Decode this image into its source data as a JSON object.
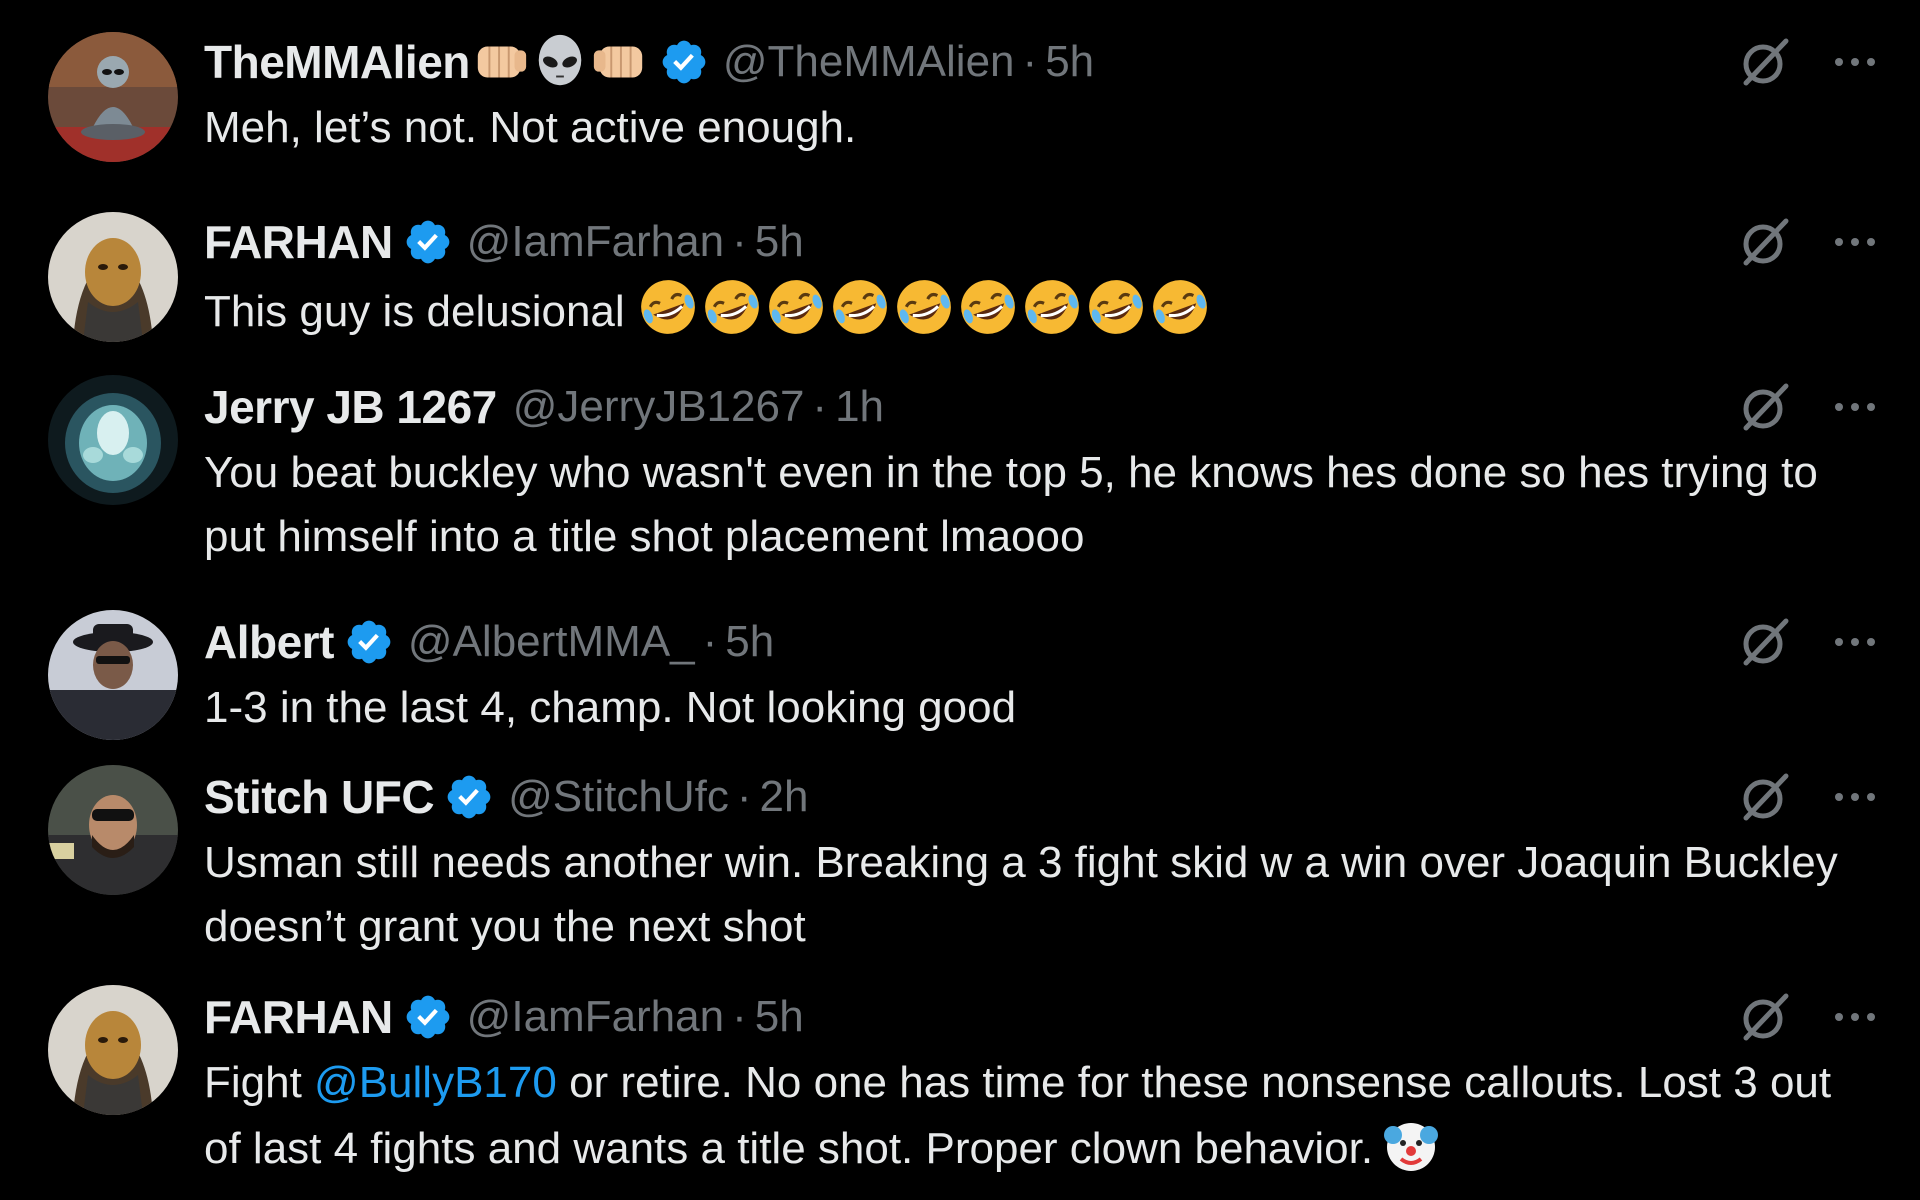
{
  "colors": {
    "background": "#000000",
    "text": "#e7e9ea",
    "muted": "#71767b",
    "accent": "#1d9bf0",
    "verified": "#1d9bf0"
  },
  "replies": [
    {
      "name": "TheMMAlien",
      "name_emojis": [
        "fist-left-emoji",
        "alien-emoji",
        "fist-right-emoji"
      ],
      "verified": true,
      "handle": "@TheMMAlien",
      "separator": "·",
      "time": "5h",
      "text": "Meh, let’s not. Not active enough."
    },
    {
      "name": "FARHAN",
      "verified": true,
      "handle": "@IamFarhan",
      "separator": "·",
      "time": "5h",
      "text": "This guy is delusional ",
      "emoji_count": 9,
      "emoji_name": "rolling-on-floor-laughing-emoji"
    },
    {
      "name": "Jerry JB 1267",
      "verified": false,
      "handle": "@JerryJB1267",
      "separator": "·",
      "time": "1h",
      "text": "You beat buckley who wasn't even in the top 5, he knows hes done so hes trying to put himself into a title shot placement lmaooo"
    },
    {
      "name": "Albert",
      "verified": true,
      "handle": "@AlbertMMA_",
      "separator": "·",
      "time": "5h",
      "text": "1-3 in the last 4, champ. Not looking good"
    },
    {
      "name": "Stitch UFC",
      "verified": true,
      "handle": "@StitchUfc",
      "separator": "·",
      "time": "2h",
      "text": "Usman still needs another win. Breaking a 3 fight skid w a win over Joaquin Buckley doesn’t grant you the next shot"
    },
    {
      "name": "FARHAN",
      "verified": true,
      "handle": "@IamFarhan",
      "separator": "·",
      "time": "5h",
      "text_before": "Fight ",
      "mention": "@BullyB170",
      "text_after": " or retire. No one has time for these nonsense callouts. Lost 3 out of last 4 fights and wants a title shot. Proper clown behavior.",
      "trailing_emoji": "clown-emoji"
    }
  ]
}
